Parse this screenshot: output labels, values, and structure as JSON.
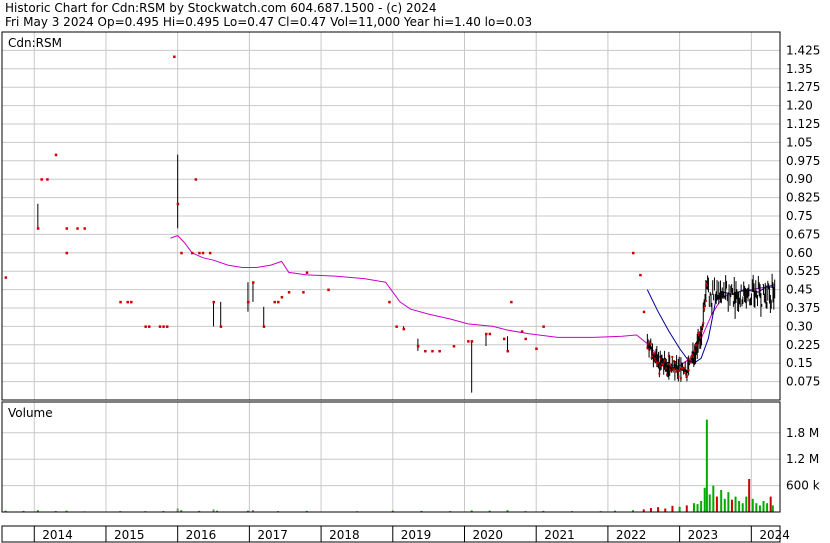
{
  "header": {
    "line1": "Historic Chart for Cdn:RSM by Stockwatch.com 604.687.1500 - (c) 2024",
    "line2": "Fri May  3 2024   Op=0.495  Hi=0.495  Lo=0.47  Cl=0.47  Vol=11,000  Year hi=1.40  lo=0.03"
  },
  "chart_data": {
    "type": "line",
    "symbol": "Cdn:RSM",
    "volume_label": "Volume",
    "price_axis": {
      "ticks": [
        "1.425",
        "1.35",
        "1.275",
        "1.20",
        "1.125",
        "1.05",
        "0.975",
        "0.90",
        "0.825",
        "0.75",
        "0.675",
        "0.60",
        "0.525",
        "0.45",
        "0.375",
        "0.30",
        "0.225",
        "0.15",
        "0.075"
      ],
      "ylim": [
        0.0,
        1.5
      ]
    },
    "volume_axis": {
      "ticks": [
        "1.8 M",
        "1.2 M",
        "600 k"
      ],
      "ylim": [
        0,
        2500000
      ]
    },
    "x_axis": {
      "labels": [
        "2014",
        "2015",
        "2016",
        "2017",
        "2018",
        "2019",
        "2020",
        "2021",
        "2022",
        "2023",
        "2024"
      ],
      "xlim": [
        2013.55,
        2024.4
      ]
    },
    "grid": true,
    "colors": {
      "bar": "#000000",
      "close_marker": "#cc0000",
      "ma_long": "#cc00cc",
      "ma_short": "#000099",
      "volume_up": "#00aa00",
      "volume_down": "#cc0000",
      "volume_neutral": "#888888",
      "grid": "#c8c8c8"
    },
    "series": [
      {
        "key": "ma_long",
        "points": [
          [
            2015.9,
            0.66
          ],
          [
            2016.0,
            0.67
          ],
          [
            2016.1,
            0.64
          ],
          [
            2016.2,
            0.6
          ],
          [
            2016.35,
            0.58
          ],
          [
            2016.5,
            0.57
          ],
          [
            2016.7,
            0.55
          ],
          [
            2016.9,
            0.54
          ],
          [
            2017.1,
            0.54
          ],
          [
            2017.3,
            0.55
          ],
          [
            2017.45,
            0.565
          ],
          [
            2017.55,
            0.52
          ],
          [
            2017.8,
            0.51
          ],
          [
            2018.2,
            0.505
          ],
          [
            2018.6,
            0.495
          ],
          [
            2018.9,
            0.48
          ],
          [
            2019.0,
            0.44
          ],
          [
            2019.1,
            0.4
          ],
          [
            2019.25,
            0.37
          ],
          [
            2019.5,
            0.35
          ],
          [
            2019.8,
            0.33
          ],
          [
            2020.05,
            0.31
          ],
          [
            2020.4,
            0.3
          ],
          [
            2020.6,
            0.285
          ],
          [
            2020.9,
            0.27
          ],
          [
            2021.3,
            0.255
          ],
          [
            2021.8,
            0.255
          ],
          [
            2022.2,
            0.26
          ],
          [
            2022.4,
            0.265
          ],
          [
            2022.55,
            0.23
          ],
          [
            2022.7,
            0.18
          ],
          [
            2022.85,
            0.14
          ],
          [
            2023.0,
            0.14
          ],
          [
            2023.15,
            0.17
          ],
          [
            2023.3,
            0.25
          ],
          [
            2023.45,
            0.35
          ],
          [
            2023.6,
            0.42
          ],
          [
            2023.8,
            0.44
          ],
          [
            2024.0,
            0.45
          ],
          [
            2024.2,
            0.46
          ],
          [
            2024.33,
            0.46
          ]
        ]
      },
      {
        "key": "ma_short",
        "points": [
          [
            2022.55,
            0.45
          ],
          [
            2022.7,
            0.36
          ],
          [
            2022.85,
            0.28
          ],
          [
            2023.0,
            0.21
          ],
          [
            2023.1,
            0.17
          ],
          [
            2023.2,
            0.15
          ],
          [
            2023.3,
            0.17
          ],
          [
            2023.4,
            0.25
          ],
          [
            2023.5,
            0.4
          ],
          [
            2023.6,
            0.44
          ],
          [
            2023.75,
            0.43
          ],
          [
            2023.9,
            0.45
          ],
          [
            2024.1,
            0.44
          ],
          [
            2024.2,
            0.46
          ],
          [
            2024.33,
            0.47
          ]
        ]
      }
    ],
    "price_bars": [
      {
        "x": 2014.05,
        "high": 0.8,
        "low": 0.7,
        "close": 0.7
      },
      {
        "x": 2014.3,
        "high": 1.0,
        "low": 1.0,
        "close": 1.0
      },
      {
        "x": 2014.1,
        "high": 0.9,
        "low": 0.9,
        "close": 0.9
      },
      {
        "x": 2014.18,
        "high": 0.9,
        "low": 0.9,
        "close": 0.9
      },
      {
        "x": 2014.45,
        "high": 0.7,
        "low": 0.7,
        "close": 0.7
      },
      {
        "x": 2014.6,
        "high": 0.7,
        "low": 0.7,
        "close": 0.7
      },
      {
        "x": 2014.7,
        "high": 0.7,
        "low": 0.7,
        "close": 0.7
      },
      {
        "x": 2014.45,
        "high": 0.6,
        "low": 0.6,
        "close": 0.6
      },
      {
        "x": 2013.6,
        "high": 0.5,
        "low": 0.5,
        "close": 0.5
      },
      {
        "x": 2015.2,
        "high": 0.4,
        "low": 0.4,
        "close": 0.4
      },
      {
        "x": 2015.3,
        "high": 0.4,
        "low": 0.4,
        "close": 0.4
      },
      {
        "x": 2015.35,
        "high": 0.4,
        "low": 0.4,
        "close": 0.4
      },
      {
        "x": 2015.55,
        "high": 0.3,
        "low": 0.3,
        "close": 0.3
      },
      {
        "x": 2015.6,
        "high": 0.3,
        "low": 0.3,
        "close": 0.3
      },
      {
        "x": 2015.75,
        "high": 0.3,
        "low": 0.3,
        "close": 0.3
      },
      {
        "x": 2015.8,
        "high": 0.3,
        "low": 0.3,
        "close": 0.3
      },
      {
        "x": 2015.85,
        "high": 0.3,
        "low": 0.3,
        "close": 0.3
      },
      {
        "x": 2015.95,
        "high": 1.4,
        "low": 1.4,
        "close": 1.4
      },
      {
        "x": 2016.0,
        "high": 1.0,
        "low": 0.7,
        "close": 0.8
      },
      {
        "x": 2016.05,
        "high": 0.6,
        "low": 0.6,
        "close": 0.6
      },
      {
        "x": 2016.2,
        "high": 0.6,
        "low": 0.6,
        "close": 0.6
      },
      {
        "x": 2016.3,
        "high": 0.6,
        "low": 0.6,
        "close": 0.6
      },
      {
        "x": 2016.35,
        "high": 0.6,
        "low": 0.6,
        "close": 0.6
      },
      {
        "x": 2016.25,
        "high": 0.9,
        "low": 0.9,
        "close": 0.9
      },
      {
        "x": 2016.45,
        "high": 0.6,
        "low": 0.6,
        "close": 0.6
      },
      {
        "x": 2016.5,
        "high": 0.4,
        "low": 0.3,
        "close": 0.4
      },
      {
        "x": 2016.6,
        "high": 0.4,
        "low": 0.3,
        "close": 0.3
      },
      {
        "x": 2016.98,
        "high": 0.48,
        "low": 0.36,
        "close": 0.4
      },
      {
        "x": 2017.05,
        "high": 0.48,
        "low": 0.4,
        "close": 0.48
      },
      {
        "x": 2017.2,
        "high": 0.38,
        "low": 0.3,
        "close": 0.3
      },
      {
        "x": 2017.35,
        "high": 0.4,
        "low": 0.4,
        "close": 0.4
      },
      {
        "x": 2017.4,
        "high": 0.4,
        "low": 0.4,
        "close": 0.4
      },
      {
        "x": 2017.45,
        "high": 0.42,
        "low": 0.42,
        "close": 0.42
      },
      {
        "x": 2017.55,
        "high": 0.44,
        "low": 0.44,
        "close": 0.44
      },
      {
        "x": 2017.75,
        "high": 0.44,
        "low": 0.44,
        "close": 0.44
      },
      {
        "x": 2017.8,
        "high": 0.52,
        "low": 0.52,
        "close": 0.52
      },
      {
        "x": 2018.1,
        "high": 0.45,
        "low": 0.45,
        "close": 0.45
      },
      {
        "x": 2018.95,
        "high": 0.4,
        "low": 0.4,
        "close": 0.4
      },
      {
        "x": 2019.05,
        "high": 0.3,
        "low": 0.3,
        "close": 0.3
      },
      {
        "x": 2019.15,
        "high": 0.3,
        "low": 0.29,
        "close": 0.29
      },
      {
        "x": 2019.35,
        "high": 0.25,
        "low": 0.2,
        "close": 0.22
      },
      {
        "x": 2019.45,
        "high": 0.2,
        "low": 0.2,
        "close": 0.2
      },
      {
        "x": 2019.55,
        "high": 0.2,
        "low": 0.2,
        "close": 0.2
      },
      {
        "x": 2019.65,
        "high": 0.2,
        "low": 0.2,
        "close": 0.2
      },
      {
        "x": 2019.85,
        "high": 0.22,
        "low": 0.22,
        "close": 0.22
      },
      {
        "x": 2020.05,
        "high": 0.24,
        "low": 0.24,
        "close": 0.24
      },
      {
        "x": 2020.1,
        "high": 0.24,
        "low": 0.03,
        "close": 0.24
      },
      {
        "x": 2020.3,
        "high": 0.27,
        "low": 0.22,
        "close": 0.27
      },
      {
        "x": 2020.35,
        "high": 0.27,
        "low": 0.27,
        "close": 0.27
      },
      {
        "x": 2020.55,
        "high": 0.25,
        "low": 0.25,
        "close": 0.25
      },
      {
        "x": 2020.6,
        "high": 0.26,
        "low": 0.2,
        "close": 0.2
      },
      {
        "x": 2020.65,
        "high": 0.4,
        "low": 0.4,
        "close": 0.4
      },
      {
        "x": 2020.8,
        "high": 0.28,
        "low": 0.28,
        "close": 0.28
      },
      {
        "x": 2020.85,
        "high": 0.25,
        "low": 0.25,
        "close": 0.25
      },
      {
        "x": 2021.0,
        "high": 0.21,
        "low": 0.21,
        "close": 0.21
      },
      {
        "x": 2021.1,
        "high": 0.3,
        "low": 0.3,
        "close": 0.3
      },
      {
        "x": 2022.35,
        "high": 0.6,
        "low": 0.6,
        "close": 0.6
      },
      {
        "x": 2022.45,
        "high": 0.51,
        "low": 0.51,
        "close": 0.51
      },
      {
        "x": 2022.5,
        "high": 0.36,
        "low": 0.36,
        "close": 0.36
      }
    ],
    "volume_bars": [
      {
        "x": 2013.6,
        "v": 30000,
        "c": "up"
      },
      {
        "x": 2013.85,
        "v": 25000,
        "c": "up"
      },
      {
        "x": 2014.05,
        "v": 40000,
        "c": "up"
      },
      {
        "x": 2014.3,
        "v": 20000,
        "c": "down"
      },
      {
        "x": 2014.45,
        "v": 30000,
        "c": "up"
      },
      {
        "x": 2014.7,
        "v": 15000,
        "c": "up"
      },
      {
        "x": 2015.2,
        "v": 20000,
        "c": "up"
      },
      {
        "x": 2015.55,
        "v": 18000,
        "c": "down"
      },
      {
        "x": 2015.8,
        "v": 22000,
        "c": "up"
      },
      {
        "x": 2016.0,
        "v": 80000,
        "c": "neutral"
      },
      {
        "x": 2016.05,
        "v": 40000,
        "c": "up"
      },
      {
        "x": 2016.3,
        "v": 25000,
        "c": "up"
      },
      {
        "x": 2016.5,
        "v": 60000,
        "c": "neutral"
      },
      {
        "x": 2016.55,
        "v": 30000,
        "c": "up"
      },
      {
        "x": 2016.98,
        "v": 30000,
        "c": "up"
      },
      {
        "x": 2017.05,
        "v": 45000,
        "c": "neutral"
      },
      {
        "x": 2017.4,
        "v": 20000,
        "c": "up"
      },
      {
        "x": 2017.8,
        "v": 25000,
        "c": "up"
      },
      {
        "x": 2018.5,
        "v": 20000,
        "c": "neutral"
      },
      {
        "x": 2019.0,
        "v": 30000,
        "c": "up"
      },
      {
        "x": 2019.4,
        "v": 25000,
        "c": "up"
      },
      {
        "x": 2019.8,
        "v": 20000,
        "c": "up"
      },
      {
        "x": 2020.1,
        "v": 35000,
        "c": "up"
      },
      {
        "x": 2020.35,
        "v": 30000,
        "c": "up"
      },
      {
        "x": 2020.6,
        "v": 40000,
        "c": "up"
      },
      {
        "x": 2020.85,
        "v": 20000,
        "c": "up"
      },
      {
        "x": 2021.1,
        "v": 25000,
        "c": "up"
      },
      {
        "x": 2021.5,
        "v": 20000,
        "c": "up"
      },
      {
        "x": 2021.9,
        "v": 20000,
        "c": "up"
      },
      {
        "x": 2022.1,
        "v": 30000,
        "c": "up"
      },
      {
        "x": 2022.35,
        "v": 40000,
        "c": "up"
      },
      {
        "x": 2022.5,
        "v": 60000,
        "c": "down"
      },
      {
        "x": 2022.6,
        "v": 90000,
        "c": "down"
      },
      {
        "x": 2022.7,
        "v": 110000,
        "c": "down"
      },
      {
        "x": 2022.8,
        "v": 80000,
        "c": "down"
      },
      {
        "x": 2022.9,
        "v": 140000,
        "c": "down"
      },
      {
        "x": 2023.0,
        "v": 120000,
        "c": "up"
      },
      {
        "x": 2023.1,
        "v": 150000,
        "c": "down"
      },
      {
        "x": 2023.2,
        "v": 200000,
        "c": "up"
      },
      {
        "x": 2023.25,
        "v": 180000,
        "c": "up"
      },
      {
        "x": 2023.3,
        "v": 250000,
        "c": "up"
      },
      {
        "x": 2023.35,
        "v": 550000,
        "c": "up"
      },
      {
        "x": 2023.38,
        "v": 2100000,
        "c": "up"
      },
      {
        "x": 2023.42,
        "v": 400000,
        "c": "up"
      },
      {
        "x": 2023.47,
        "v": 600000,
        "c": "up"
      },
      {
        "x": 2023.52,
        "v": 350000,
        "c": "down"
      },
      {
        "x": 2023.58,
        "v": 500000,
        "c": "up"
      },
      {
        "x": 2023.63,
        "v": 300000,
        "c": "up"
      },
      {
        "x": 2023.68,
        "v": 450000,
        "c": "up"
      },
      {
        "x": 2023.73,
        "v": 280000,
        "c": "down"
      },
      {
        "x": 2023.78,
        "v": 350000,
        "c": "up"
      },
      {
        "x": 2023.83,
        "v": 250000,
        "c": "up"
      },
      {
        "x": 2023.88,
        "v": 200000,
        "c": "up"
      },
      {
        "x": 2023.93,
        "v": 350000,
        "c": "up"
      },
      {
        "x": 2023.97,
        "v": 750000,
        "c": "down"
      },
      {
        "x": 2024.02,
        "v": 300000,
        "c": "up"
      },
      {
        "x": 2024.07,
        "v": 200000,
        "c": "up"
      },
      {
        "x": 2024.12,
        "v": 150000,
        "c": "up"
      },
      {
        "x": 2024.17,
        "v": 250000,
        "c": "up"
      },
      {
        "x": 2024.22,
        "v": 200000,
        "c": "up"
      },
      {
        "x": 2024.27,
        "v": 350000,
        "c": "down"
      },
      {
        "x": 2024.3,
        "v": 150000,
        "c": "up"
      }
    ]
  }
}
